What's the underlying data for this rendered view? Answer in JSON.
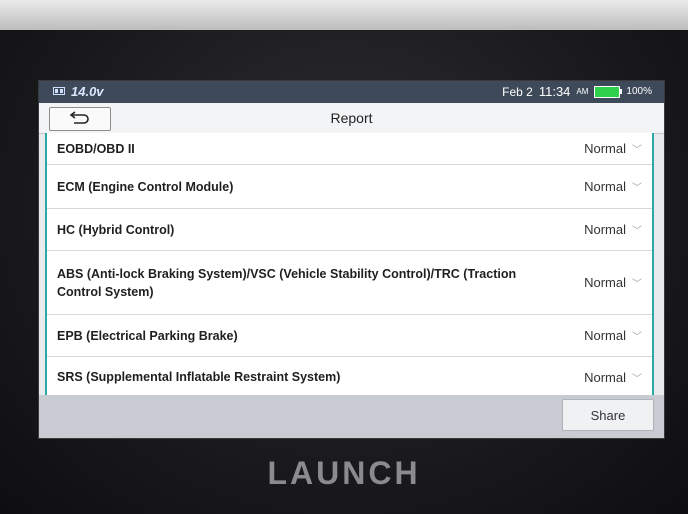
{
  "statusbar": {
    "voltage": "14.0v",
    "date": "Feb 2",
    "time": "11:34",
    "ampm": "AM",
    "battery": "100%"
  },
  "header": {
    "title": "Report"
  },
  "systems": [
    {
      "label": "EOBD/OBD II",
      "status": "Normal"
    },
    {
      "label": "ECM (Engine Control Module)",
      "status": "Normal"
    },
    {
      "label": "HC (Hybrid Control)",
      "status": "Normal"
    },
    {
      "label": "ABS (Anti-lock Braking System)/VSC (Vehicle Stability Control)/TRC (Traction Control System)",
      "status": "Normal"
    },
    {
      "label": "EPB (Electrical Parking Brake)",
      "status": "Normal"
    },
    {
      "label": "SRS (Supplemental Inflatable Restraint System)",
      "status": "Normal"
    }
  ],
  "footer": {
    "share_label": "Share"
  },
  "device": {
    "brand": "LAUNCH"
  },
  "colors": {
    "statusbar_bg": "#3e4a5a",
    "accent": "#2aa7a7",
    "battery": "#2fd04b"
  }
}
